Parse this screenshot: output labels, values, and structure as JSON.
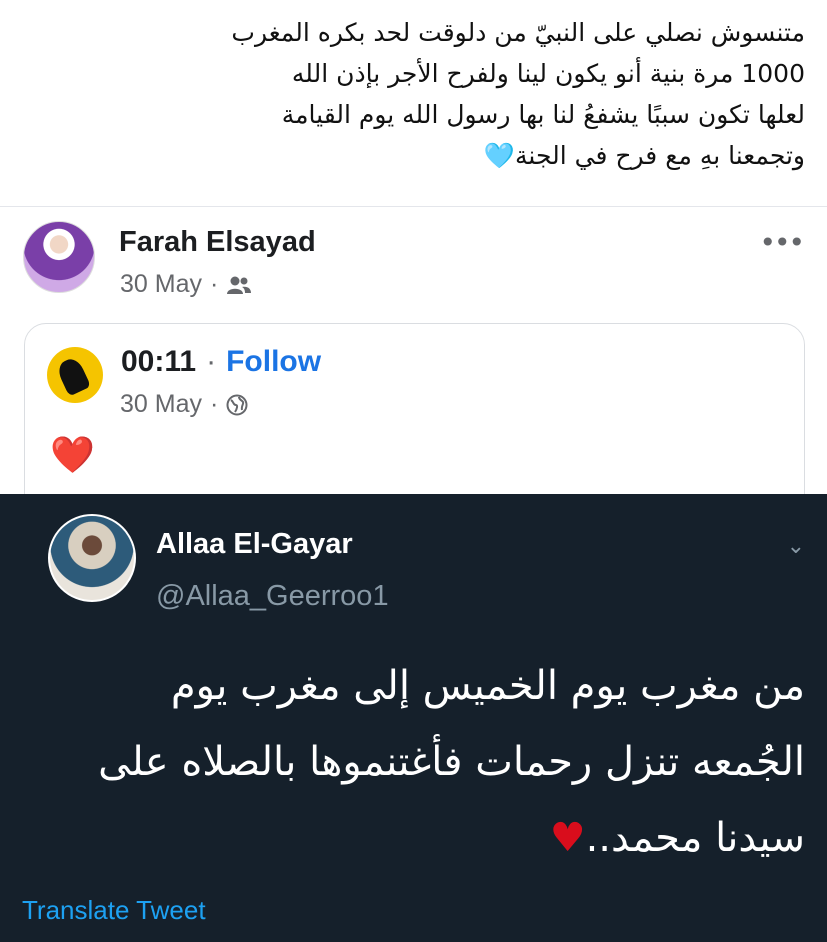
{
  "top_post": {
    "lines": [
      "متنسوش نصلي على النبيّ من دلوقت لحد بكره المغرب",
      "1000 مرة بنية أنو يكون لينا ولفرح الأجر بإذن الله",
      "لعلها تكون سببًا يشفعُ لنا بها رسول الله يوم القيامة",
      "وتجمعنا بهِ مع فرح في الجنة"
    ],
    "heart": "🩵"
  },
  "fb_post": {
    "author": "Farah Elsayad",
    "date": "30 May",
    "separator": "·",
    "privacy_icon": "friends-icon",
    "more": "•••"
  },
  "shared_post": {
    "author": "00:11",
    "separator": "·",
    "follow_label": "Follow",
    "date": "30 May",
    "privacy_icon": "globe-icon",
    "reaction": "❤️"
  },
  "tweet": {
    "name": "Allaa El-Gayar",
    "handle": "@Allaa_Geerroo1",
    "lines": [
      "من مغرب يوم الخميس إلى مغرب يوم",
      "الجُمعه تنزل رحمات فأغتنموها بالصلاه على",
      "سيدنا محمد.."
    ],
    "heart": "♥",
    "translate_label": "Translate Tweet",
    "chevron": "⌄"
  },
  "colors": {
    "tweet_bg": "#15202b",
    "fb_blue": "#1b74e4",
    "twitter_blue": "#1da1f2"
  }
}
